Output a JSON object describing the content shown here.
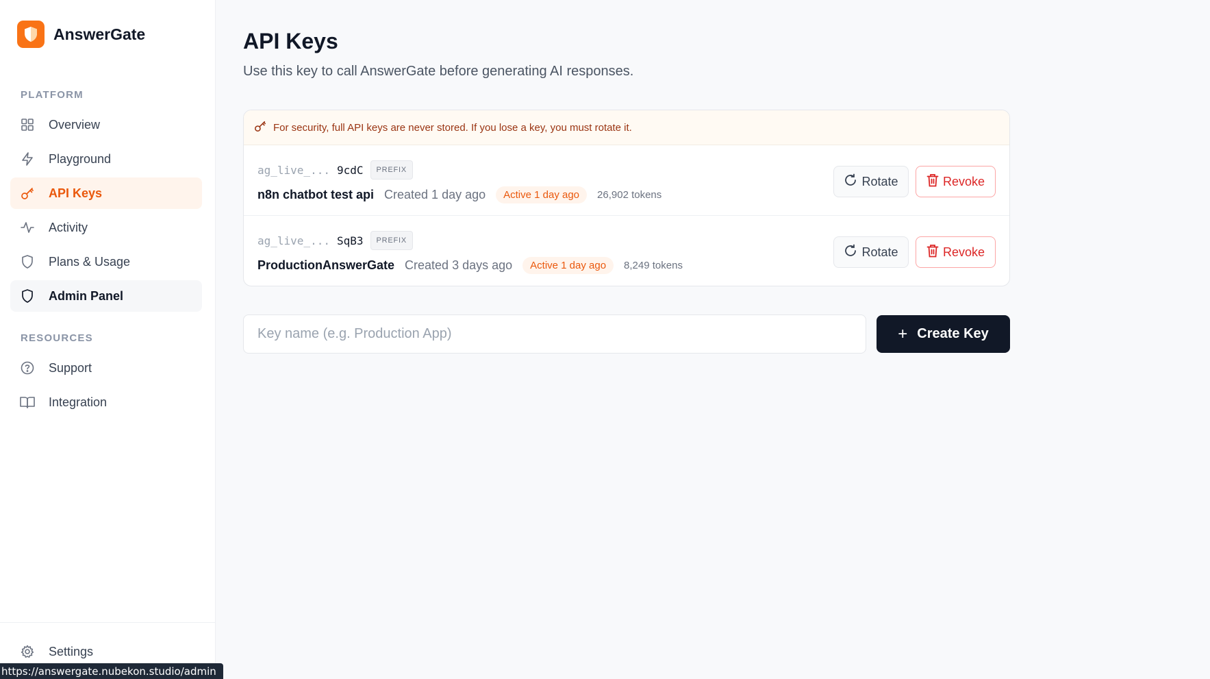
{
  "brand": {
    "name": "AnswerGate"
  },
  "sidebar": {
    "sections": [
      {
        "label": "PLATFORM"
      },
      {
        "label": "RESOURCES"
      }
    ],
    "items": [
      {
        "label": "Overview",
        "icon": "grid-icon"
      },
      {
        "label": "Playground",
        "icon": "bolt-icon"
      },
      {
        "label": "API Keys",
        "icon": "key-icon"
      },
      {
        "label": "Activity",
        "icon": "activity-icon"
      },
      {
        "label": "Plans & Usage",
        "icon": "shield-icon"
      },
      {
        "label": "Admin Panel",
        "icon": "shield-icon"
      },
      {
        "label": "Support",
        "icon": "help-circle-icon"
      },
      {
        "label": "Integration",
        "icon": "book-icon"
      }
    ],
    "settings": {
      "label": "Settings",
      "icon": "gear-icon"
    }
  },
  "status_bar": {
    "url": "https://answergate.nubekon.studio/admin"
  },
  "page": {
    "title": "API Keys",
    "subtitle": "Use this key to call AnswerGate before generating AI responses."
  },
  "notice": {
    "text": "For security, full API keys are never stored. If you lose a key, you must rotate it."
  },
  "keys": [
    {
      "prefix_mask": "ag_live_...",
      "prefix_tail": "9cdC",
      "badge": "PREFIX",
      "name": "n8n chatbot test api",
      "created": "Created 1 day ago",
      "active": "Active 1 day ago",
      "tokens": "26,902 tokens",
      "rotate_label": "Rotate",
      "revoke_label": "Revoke"
    },
    {
      "prefix_mask": "ag_live_...",
      "prefix_tail": "SqB3",
      "badge": "PREFIX",
      "name": "ProductionAnswerGate",
      "created": "Created 3 days ago",
      "active": "Active 1 day ago",
      "tokens": "8,249 tokens",
      "rotate_label": "Rotate",
      "revoke_label": "Revoke"
    }
  ],
  "create": {
    "placeholder": "Key name (e.g. Production App)",
    "value": "",
    "button_label": "Create Key"
  },
  "colors": {
    "accent": "#f97316",
    "accent_text": "#ea580c",
    "danger": "#dc2626",
    "dark_button": "#111827"
  }
}
